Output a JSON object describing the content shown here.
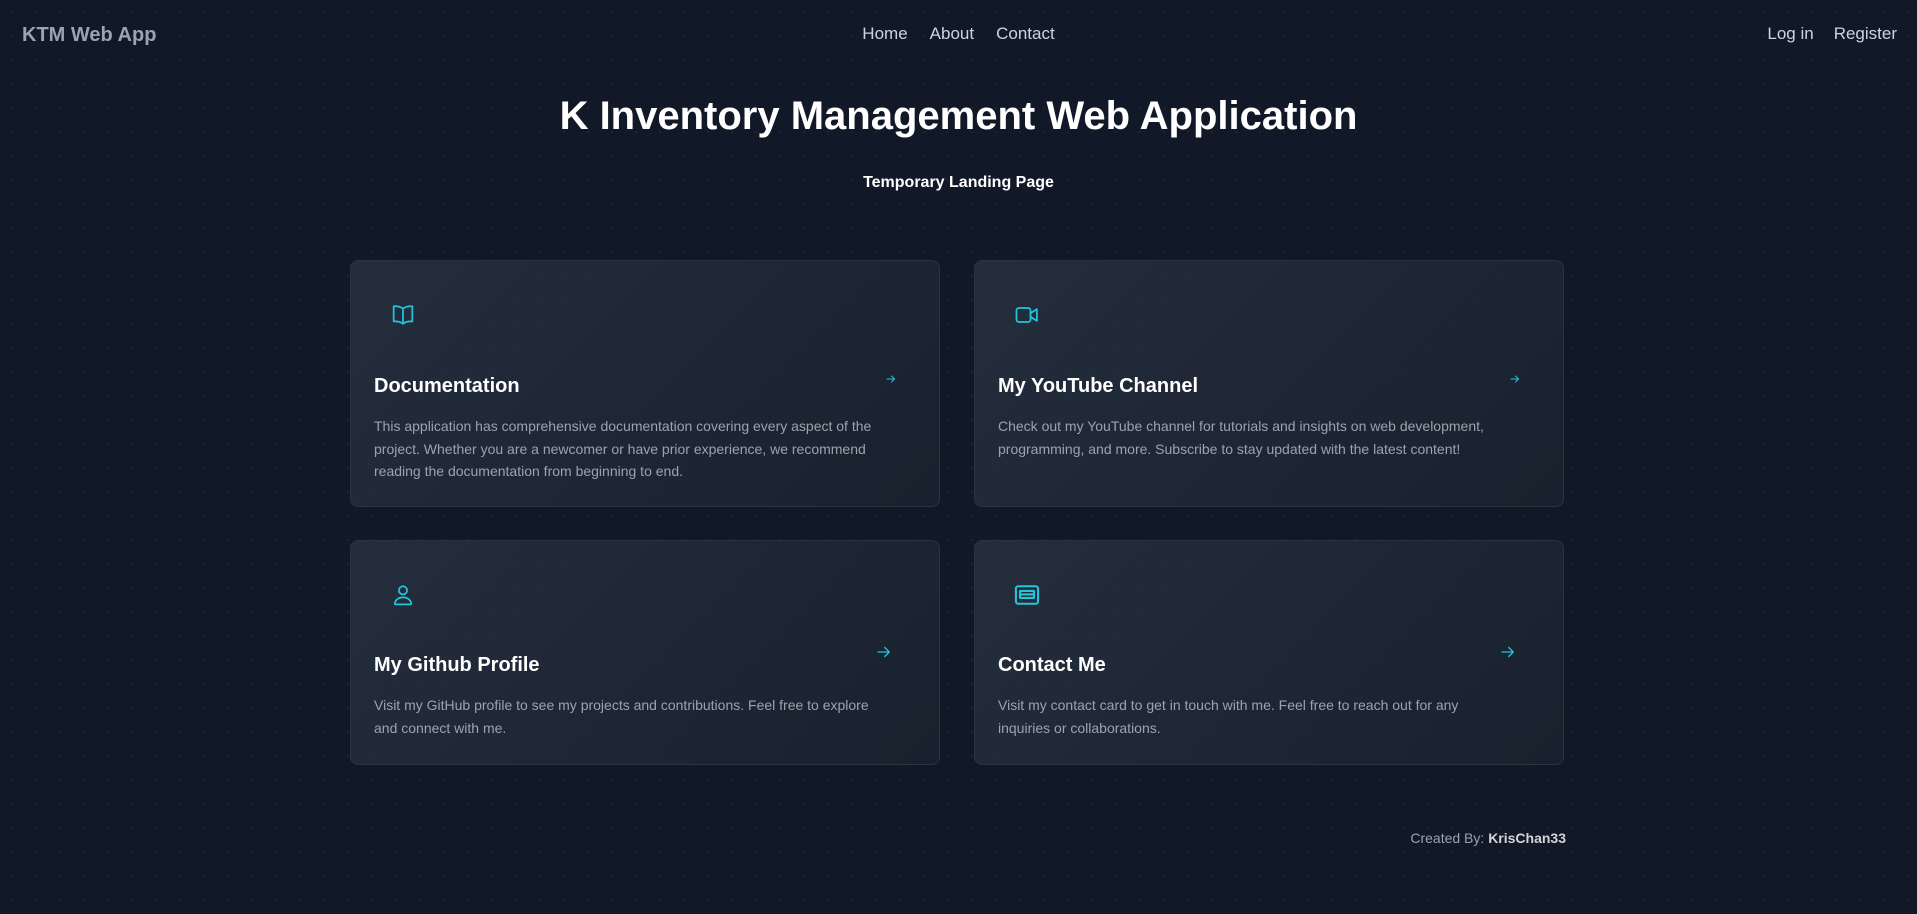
{
  "header": {
    "brand": "KTM Web App",
    "nav": [
      "Home",
      "About",
      "Contact"
    ],
    "auth": [
      "Log in",
      "Register"
    ]
  },
  "hero": {
    "title": "K Inventory Management Web Application",
    "subtitle": "Temporary Landing Page"
  },
  "cards": [
    {
      "icon": "book-open-icon",
      "title": "Documentation",
      "text": "This application has comprehensive documentation covering every aspect of the project. Whether you are a newcomer or have prior experience, we recommend reading the documentation from beginning to end."
    },
    {
      "icon": "video-camera-icon",
      "title": "My YouTube Channel",
      "text": "Check out my YouTube channel for tutorials and insights on web development, programming, and more. Subscribe to stay updated with the latest content!"
    },
    {
      "icon": "user-icon",
      "title": "My Github Profile",
      "text": "Visit my GitHub profile to see my projects and contributions. Feel free to explore and connect with me."
    },
    {
      "icon": "contact-card-icon",
      "title": "Contact Me",
      "text": "Visit my contact card to get in touch with me. Feel free to reach out for any inquiries or collaborations."
    }
  ],
  "footer": {
    "label": "Created By:",
    "author": "KrisChan33"
  },
  "colors": {
    "background": "#111827",
    "accent": "#22c5da",
    "card_border": "#2a3441",
    "muted_text": "#9ca3af"
  }
}
